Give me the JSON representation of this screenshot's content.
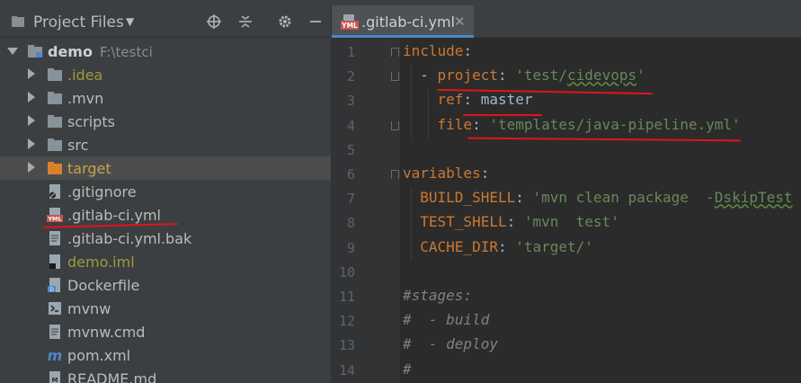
{
  "project_panel": {
    "title": "Project Files",
    "caret": "▼",
    "header_icons": [
      "crosshair-icon",
      "collapse-all-icon",
      "gear-icon",
      "minimize-icon"
    ]
  },
  "tree": [
    {
      "label": "demo",
      "path": "F:\\testci",
      "kind": "root",
      "icon": "module-folder-icon",
      "expanded": true
    },
    {
      "label": ".idea",
      "kind": "folder",
      "style": "excluded",
      "icon": "folder-icon"
    },
    {
      "label": ".mvn",
      "kind": "folder",
      "icon": "folder-icon"
    },
    {
      "label": "scripts",
      "kind": "folder",
      "icon": "folder-icon"
    },
    {
      "label": "src",
      "kind": "folder",
      "icon": "folder-icon"
    },
    {
      "label": "target",
      "kind": "folder",
      "style": "target",
      "icon": "excluded-folder-icon",
      "selected": true
    },
    {
      "label": ".gitignore",
      "kind": "file",
      "icon": "ignored-file-icon"
    },
    {
      "label": ".gitlab-ci.yml",
      "kind": "file",
      "icon": "yml-file-icon"
    },
    {
      "label": ".gitlab-ci.yml.bak",
      "kind": "file",
      "icon": "text-file-icon"
    },
    {
      "label": "demo.iml",
      "kind": "file",
      "style": "excluded",
      "icon": "iml-file-icon"
    },
    {
      "label": "Dockerfile",
      "kind": "file",
      "icon": "dockerfile-icon"
    },
    {
      "label": "mvnw",
      "kind": "file",
      "icon": "shell-file-icon"
    },
    {
      "label": "mvnw.cmd",
      "kind": "file",
      "icon": "text-file-icon"
    },
    {
      "label": "pom.xml",
      "kind": "file",
      "icon": "maven-file-icon"
    },
    {
      "label": "README.md",
      "kind": "file",
      "icon": "markdown-file-icon"
    }
  ],
  "editor": {
    "tab": {
      "label": ".gitlab-ci.yml",
      "icon_text": "YML",
      "close": "✕"
    },
    "line_numbers": [
      "1",
      "2",
      "3",
      "4",
      "5",
      "6",
      "7",
      "8",
      "9",
      "10",
      "11",
      "12",
      "13",
      "14"
    ],
    "lines": [
      [
        {
          "t": "include",
          "c": "k"
        },
        {
          "t": ":",
          "c": "p"
        }
      ],
      [
        {
          "t": "  - ",
          "c": "p"
        },
        {
          "t": "project",
          "c": "k"
        },
        {
          "t": ": ",
          "c": "p"
        },
        {
          "t": "'test/",
          "c": "s"
        },
        {
          "t": "cidevops",
          "c": "s typo"
        },
        {
          "t": "'",
          "c": "s"
        }
      ],
      [
        {
          "t": "    ",
          "c": "p"
        },
        {
          "t": "ref",
          "c": "k"
        },
        {
          "t": ": master",
          "c": "p"
        }
      ],
      [
        {
          "t": "    ",
          "c": "p"
        },
        {
          "t": "file",
          "c": "k"
        },
        {
          "t": ": ",
          "c": "p"
        },
        {
          "t": "'templates/java-pipeline.yml'",
          "c": "s"
        }
      ],
      [],
      [
        {
          "t": "variables",
          "c": "k"
        },
        {
          "t": ":",
          "c": "p"
        }
      ],
      [
        {
          "t": "  ",
          "c": "p"
        },
        {
          "t": "BUILD_SHELL",
          "c": "k"
        },
        {
          "t": ": ",
          "c": "p"
        },
        {
          "t": "'mvn clean package  -",
          "c": "s"
        },
        {
          "t": "DskipTest",
          "c": "s typo"
        }
      ],
      [
        {
          "t": "  ",
          "c": "p"
        },
        {
          "t": "TEST_SHELL",
          "c": "k"
        },
        {
          "t": ": ",
          "c": "p"
        },
        {
          "t": "'mvn  test'",
          "c": "s"
        }
      ],
      [
        {
          "t": "  ",
          "c": "p"
        },
        {
          "t": "CACHE_DIR",
          "c": "k"
        },
        {
          "t": ": ",
          "c": "p"
        },
        {
          "t": "'target/'",
          "c": "s"
        }
      ],
      [],
      [
        {
          "t": "#stages:",
          "c": "c"
        }
      ],
      [
        {
          "t": "#  - build",
          "c": "c"
        }
      ],
      [
        {
          "t": "#  - deploy",
          "c": "c"
        }
      ],
      [
        {
          "t": "#",
          "c": "c"
        }
      ]
    ]
  },
  "colors": {
    "keyword": "#cc7832",
    "string": "#6a8759",
    "comment": "#808080",
    "annotation": "#e0141b"
  }
}
